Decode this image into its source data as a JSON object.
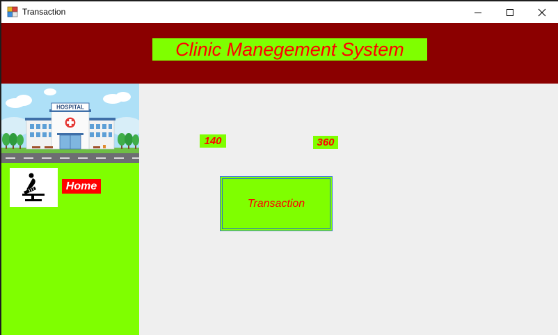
{
  "window": {
    "title": "Transaction",
    "icon": "app-window-icon",
    "controls": [
      "minimize-icon",
      "maximize-icon",
      "close-icon"
    ]
  },
  "header": {
    "title": "Clinic Manegement System"
  },
  "sidebar": {
    "banner_image": "hospital-illustration",
    "banner_sign": "HOSPITAL",
    "home_icon": "massage-bed-icon",
    "home_label": "Home"
  },
  "main": {
    "count_1": "140",
    "count_2": "360",
    "transaction_button": "Transaction"
  },
  "colors": {
    "header_bg": "#8b0000",
    "accent_green": "#7fff00",
    "accent_red": "#ff0000",
    "content_bg": "#efefef"
  }
}
